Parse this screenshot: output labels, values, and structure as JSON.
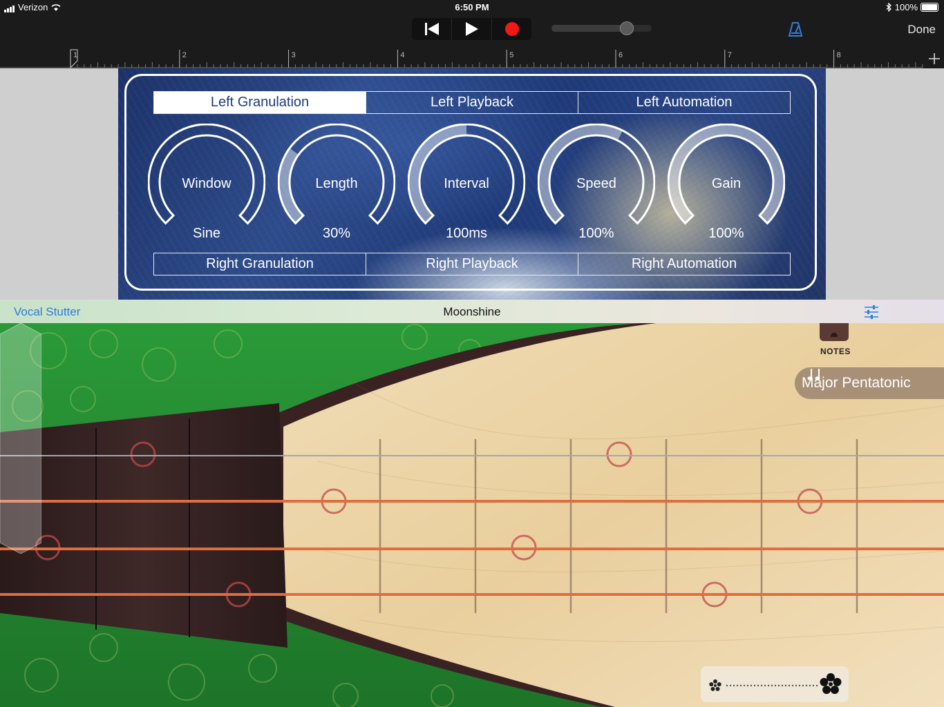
{
  "status": {
    "carrier": "Verizon",
    "time": "6:50 PM",
    "battery": "100%"
  },
  "toolbar": {
    "rewind_icon": "rewind-to-start-icon",
    "play_icon": "play-icon",
    "record_icon": "record-icon",
    "volume": 0.78,
    "metronome_icon": "metronome-icon",
    "done_label": "Done",
    "record_color": "#f01818",
    "accent": "#2f7fe0"
  },
  "ruler": {
    "markers": [
      "1",
      "2",
      "3",
      "4",
      "5",
      "6",
      "7",
      "8"
    ],
    "add_icon": "plus-icon"
  },
  "plugin": {
    "top_tabs": [
      "Left Granulation",
      "Left Playback",
      "Left Automation"
    ],
    "active_tab": "Left Granulation",
    "knobs": [
      {
        "name": "Window",
        "value": "Sine",
        "level": 0.0
      },
      {
        "name": "Length",
        "value": "30%",
        "level": 0.3
      },
      {
        "name": "Interval",
        "value": "100ms",
        "level": 0.5
      },
      {
        "name": "Speed",
        "value": "100%",
        "level": 0.6
      },
      {
        "name": "Gain",
        "value": "100%",
        "level": 1.0
      }
    ],
    "bottom_tabs": [
      "Right Granulation",
      "Right Playback",
      "Right Automation"
    ]
  },
  "instrument_header": {
    "preset": "Vocal Stutter",
    "song": "Moonshine",
    "mixer_icon": "mixer-settings-icon"
  },
  "instrument": {
    "notes_label": "NOTES",
    "scale_icon": "music-notes-icon",
    "scale_label": "Major Pentatonic",
    "autoplay_icon_small": "autoplay-small-icon",
    "autoplay_icon_large": "autoplay-large-icon"
  }
}
